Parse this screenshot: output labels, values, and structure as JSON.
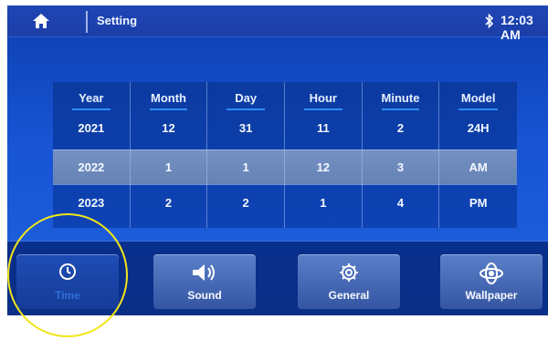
{
  "statusbar": {
    "title": "Setting",
    "time": "12:03 AM",
    "icons": [
      "home-icon",
      "bluetooth-icon"
    ]
  },
  "picker": {
    "columns": [
      {
        "header": "Year",
        "values": [
          "2021",
          "2022",
          "2023"
        ]
      },
      {
        "header": "Month",
        "values": [
          "12",
          "1",
          "2"
        ]
      },
      {
        "header": "Day",
        "values": [
          "31",
          "1",
          "2"
        ]
      },
      {
        "header": "Hour",
        "values": [
          "11",
          "12",
          "1"
        ]
      },
      {
        "header": "Minute",
        "values": [
          "2",
          "3",
          "4"
        ]
      },
      {
        "header": "Model",
        "values": [
          "24H",
          "AM",
          "PM"
        ]
      }
    ],
    "selected_row_index": 1
  },
  "dock": {
    "items": [
      {
        "label": "Time",
        "icon": "clock-icon",
        "active": true
      },
      {
        "label": "Sound",
        "icon": "speaker-icon",
        "active": false
      },
      {
        "label": "General",
        "icon": "gear-icon",
        "active": false
      },
      {
        "label": "Wallpaper",
        "icon": "wallpaper-icon",
        "active": false
      }
    ]
  },
  "colors": {
    "accent": "#2d8cff",
    "annotation": "#f2e51b",
    "screen_bg": "#1854d4"
  }
}
